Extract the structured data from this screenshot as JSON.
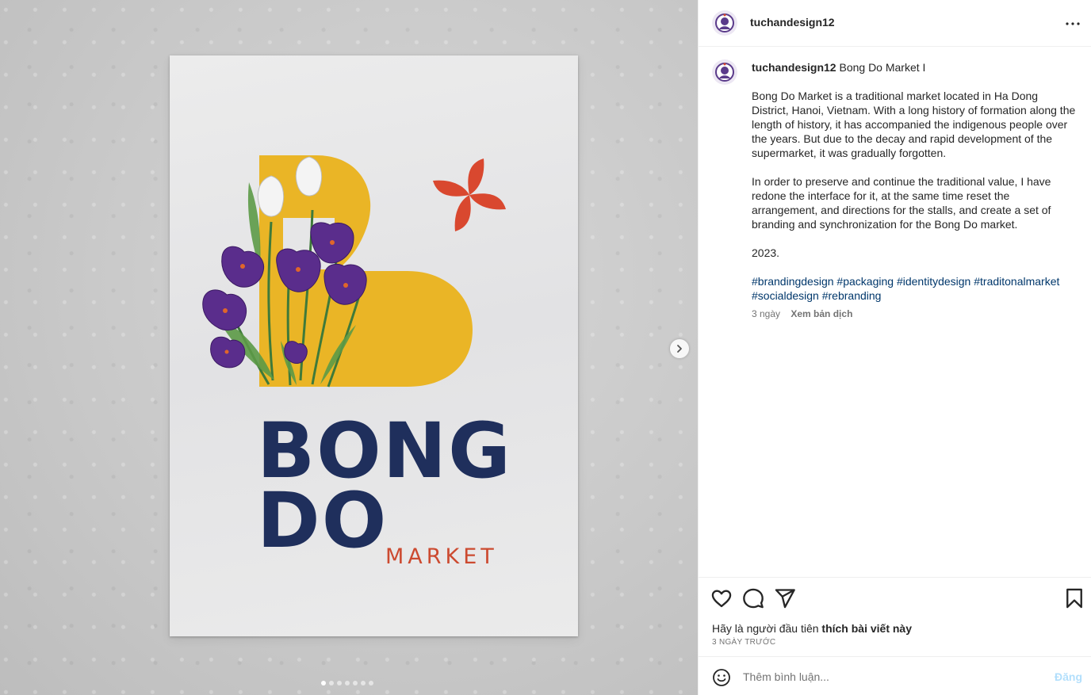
{
  "post": {
    "username": "tuchandesign12",
    "more_icon": "more-horizontal-icon",
    "caption": {
      "username": "tuchandesign12",
      "title": "Bong Do Market I",
      "paragraph1": "Bong Do Market is a traditional market located in Ha Dong District, Hanoi, Vietnam. With a long history of formation along the length of history, it has accompanied the indigenous people over the years. But due to the decay and rapid development of the supermarket, it was gradually forgotten.",
      "paragraph2": "In order to preserve and continue the traditional value, I have redone the interface for it, at the same time reset the arrangement, and directions for the stalls, and create a set of branding and synchronization for the Bong Do market.",
      "year": "2023.",
      "hashtags": [
        "#brandingdesign",
        "#packaging",
        "#identitydesign",
        "#traditonalmarket",
        "#socialdesign",
        "#rebranding"
      ]
    },
    "time_ago": "3 ngày",
    "translate_label": "Xem bản dịch",
    "likes_prefix": "Hãy là người đầu tiên",
    "likes_bold": "thích bài viết này",
    "date_label": "3 NGÀY TRƯỚC",
    "comment_placeholder": "Thêm bình luận...",
    "post_button": "Đăng"
  },
  "media": {
    "poster_title_line1": "BONG",
    "poster_title_line2": "DO",
    "poster_subtitle": "MARKET",
    "carousel_count": 7,
    "carousel_active": 0,
    "colors": {
      "navy": "#1f2f5c",
      "yellow": "#eab526",
      "red": "#d9482f",
      "purple": "#5a2d8c"
    }
  },
  "icons": {
    "like": "heart-icon",
    "comment": "comment-icon",
    "share": "send-icon",
    "save": "bookmark-icon",
    "emoji": "emoji-icon",
    "next": "chevron-right-icon"
  }
}
